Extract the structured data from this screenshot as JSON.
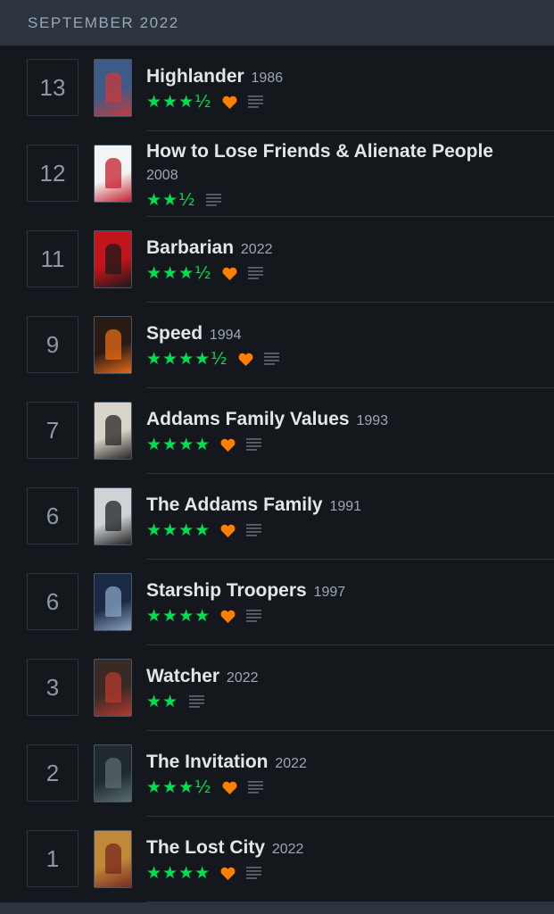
{
  "header": {
    "month": "SEPTEMBER 2022"
  },
  "entries": [
    {
      "day": "13",
      "title": "Highlander",
      "year": "1986",
      "stars": "★★★½",
      "liked": true,
      "review": true,
      "poster_bg": "#3d5a88",
      "poster_accent": "#c83b3b"
    },
    {
      "day": "12",
      "title": "How to Lose Friends & Alienate People",
      "year": "2008",
      "stars": "★★½",
      "liked": false,
      "review": true,
      "poster_bg": "#f4f4f4",
      "poster_accent": "#c31f2c"
    },
    {
      "day": "11",
      "title": "Barbarian",
      "year": "2022",
      "stars": "★★★½",
      "liked": true,
      "review": true,
      "poster_bg": "#c2141a",
      "poster_accent": "#1a1a1a"
    },
    {
      "day": "9",
      "title": "Speed",
      "year": "1994",
      "stars": "★★★★½",
      "liked": true,
      "review": true,
      "poster_bg": "#2a1a14",
      "poster_accent": "#e66a16"
    },
    {
      "day": "7",
      "title": "Addams Family Values",
      "year": "1993",
      "stars": "★★★★",
      "liked": true,
      "review": true,
      "poster_bg": "#d9d4c9",
      "poster_accent": "#2a2424"
    },
    {
      "day": "6",
      "title": "The Addams Family",
      "year": "1991",
      "stars": "★★★★",
      "liked": true,
      "review": true,
      "poster_bg": "#cfd3d6",
      "poster_accent": "#222222"
    },
    {
      "day": "6",
      "title": "Starship Troopers",
      "year": "1997",
      "stars": "★★★★",
      "liked": true,
      "review": true,
      "poster_bg": "#1b2a44",
      "poster_accent": "#8aa3c2"
    },
    {
      "day": "3",
      "title": "Watcher",
      "year": "2022",
      "stars": "★★",
      "liked": false,
      "review": true,
      "poster_bg": "#3a2a26",
      "poster_accent": "#b43a2e"
    },
    {
      "day": "2",
      "title": "The Invitation",
      "year": "2022",
      "stars": "★★★½",
      "liked": true,
      "review": true,
      "poster_bg": "#1e2a2e",
      "poster_accent": "#5b6c6e"
    },
    {
      "day": "1",
      "title": "The Lost City",
      "year": "2022",
      "stars": "★★★★",
      "liked": true,
      "review": true,
      "poster_bg": "#c0893a",
      "poster_accent": "#7a2a1e"
    }
  ],
  "colors": {
    "background": "#14181c",
    "header_bg": "#2c3440",
    "stars": "#00e054",
    "heart": "#ff8000",
    "review_icon": "#56626f"
  }
}
